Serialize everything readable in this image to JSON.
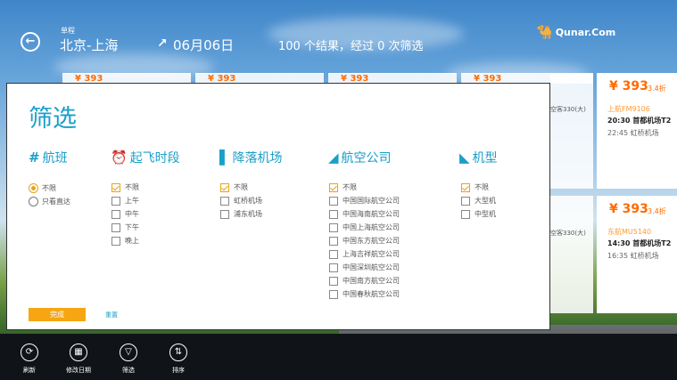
{
  "header": {
    "subtitle": "单程",
    "route": "北京-上海",
    "date": "06月06日",
    "results": "100 个结果，经过 0 次筛选",
    "logo": "Qunar.Com"
  },
  "background_cards": [
    {
      "price": "¥ 393",
      "discount": "3.4折",
      "flight": "上航FM9106",
      "depart": "20:30 首都机场T2",
      "arrive": "22:45 虹桥机场"
    },
    {
      "price": "¥ 393",
      "discount": "3.4折",
      "flight": "东航MU5140",
      "depart": "14:30 首都机场T2",
      "arrive": "16:35 虹桥机场"
    }
  ],
  "peek_texts": [
    "空客330(大)",
    "空客330(大)"
  ],
  "peek_prices": [
    "¥ 393",
    "¥ 393",
    "¥ 393",
    "¥ 393"
  ],
  "filter": {
    "title": "筛选",
    "columns": [
      {
        "id": "flight",
        "label": "航班",
        "icon": "hash-icon",
        "type": "radio",
        "options": [
          {
            "label": "不限",
            "checked": true
          },
          {
            "label": "只看直达",
            "checked": false
          }
        ]
      },
      {
        "id": "time",
        "label": "起飞时段",
        "icon": "alarm-clock-icon",
        "type": "checkbox",
        "options": [
          {
            "label": "不限",
            "checked": true
          },
          {
            "label": "上午",
            "checked": false
          },
          {
            "label": "中午",
            "checked": false
          },
          {
            "label": "下午",
            "checked": false
          },
          {
            "label": "晚上",
            "checked": false
          }
        ]
      },
      {
        "id": "airport",
        "label": "降落机场",
        "icon": "landing-icon",
        "type": "checkbox",
        "options": [
          {
            "label": "不限",
            "checked": true
          },
          {
            "label": "虹桥机场",
            "checked": false
          },
          {
            "label": "浦东机场",
            "checked": false
          }
        ]
      },
      {
        "id": "airline",
        "label": "航空公司",
        "icon": "airline-tail-icon",
        "type": "checkbox",
        "options": [
          {
            "label": "不限",
            "checked": true
          },
          {
            "label": "中国国际航空公司",
            "checked": false
          },
          {
            "label": "中国海南航空公司",
            "checked": false
          },
          {
            "label": "中国上海航空公司",
            "checked": false
          },
          {
            "label": "中国东方航空公司",
            "checked": false
          },
          {
            "label": "上海吉祥航空公司",
            "checked": false
          },
          {
            "label": "中国深圳航空公司",
            "checked": false
          },
          {
            "label": "中国南方航空公司",
            "checked": false
          },
          {
            "label": "中国春秋航空公司",
            "checked": false
          }
        ]
      },
      {
        "id": "aircraft",
        "label": "机型",
        "icon": "plane-icon",
        "type": "checkbox",
        "options": [
          {
            "label": "不限",
            "checked": true
          },
          {
            "label": "大型机",
            "checked": false
          },
          {
            "label": "中型机",
            "checked": false
          }
        ]
      }
    ],
    "done_label": "完成",
    "reset_label": "重置"
  },
  "appbar": [
    {
      "label": "刷新",
      "icon": "refresh-icon"
    },
    {
      "label": "修改日期",
      "icon": "calendar-icon"
    },
    {
      "label": "筛选",
      "icon": "filter-icon"
    },
    {
      "label": "排序",
      "icon": "sort-icon"
    }
  ],
  "colors": {
    "accent": "#1a9fc9",
    "price": "#ff6a00",
    "checked": "#e8a317",
    "button": "#f6a613"
  }
}
